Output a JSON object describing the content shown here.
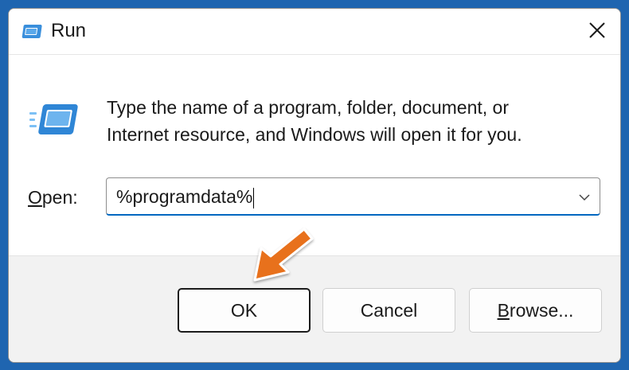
{
  "window": {
    "title": "Run",
    "icon": "run-app-icon",
    "close_icon": "close-icon"
  },
  "description": {
    "line1": "Type the name of a program, folder, document, or",
    "line2": "Internet resource, and Windows will open it for you."
  },
  "open": {
    "label_access_key": "O",
    "label_rest": "pen:",
    "value": "%programdata%",
    "dropdown_icon": "chevron-down-icon"
  },
  "buttons": {
    "ok": "OK",
    "cancel": "Cancel",
    "browse_access_key": "B",
    "browse_rest": "rowse..."
  },
  "annotation": {
    "icon": "orange-arrow-pointer",
    "color": "#e8711c"
  },
  "colors": {
    "background": "#1f65b0",
    "accent": "#0067c0"
  }
}
